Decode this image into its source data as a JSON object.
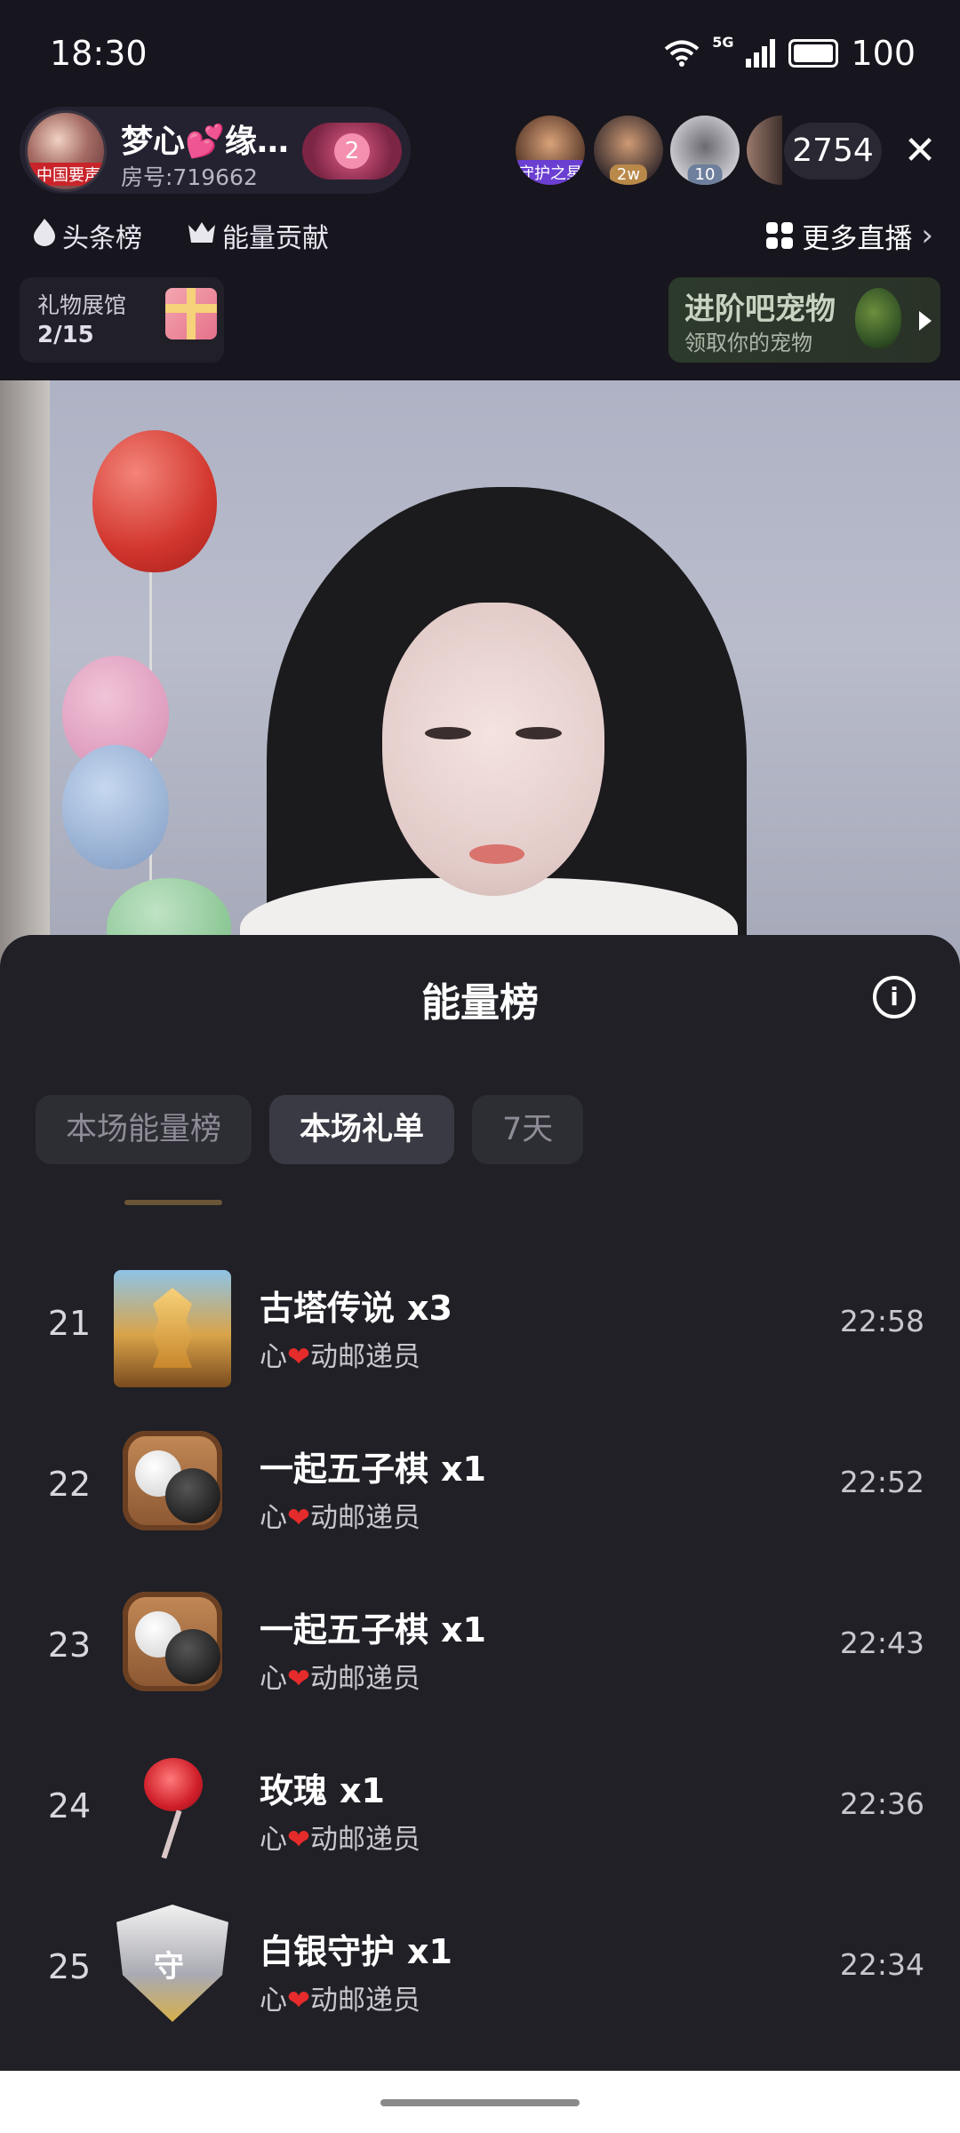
{
  "status_bar": {
    "time": "18:30",
    "network": "5G",
    "battery": "100"
  },
  "room": {
    "host_name": "梦心💕缘…",
    "host_badge": "中国要声",
    "room_number": "房号:719662",
    "fan_level": "2",
    "viewers": [
      {
        "tag": "守护之星",
        "tag_color": "#6a3fd1"
      },
      {
        "tag": "2w",
        "tag_color": "#b9894a"
      },
      {
        "tag": "10",
        "tag_color": "#6d7f9c"
      }
    ],
    "viewer_count": "2754",
    "close_label": "✕"
  },
  "chips": {
    "headline": "头条榜",
    "energy_contrib": "能量贡献",
    "more_live": "更多直播"
  },
  "gift_gallery": {
    "label": "礼物展馆",
    "count": "2/15"
  },
  "pet_banner": {
    "title": "进阶吧宠物",
    "subtitle": "领取你的宠物"
  },
  "sheet": {
    "title": "能量榜",
    "tabs": [
      {
        "label": "本场能量榜",
        "active": false
      },
      {
        "label": "本场礼单",
        "active": true
      },
      {
        "label": "7天",
        "active": false
      }
    ],
    "rows": [
      {
        "rank": "21",
        "gift": "古塔传说",
        "qty": "x3",
        "sender_prefix": "心",
        "sender_heart": "❤",
        "sender_suffix": "动邮递员",
        "time": "22:58",
        "icon": "tower-icon"
      },
      {
        "rank": "22",
        "gift": "一起五子棋",
        "qty": "x1",
        "sender_prefix": "心",
        "sender_heart": "❤",
        "sender_suffix": "动邮递员",
        "time": "22:52",
        "icon": "gomoku-icon"
      },
      {
        "rank": "23",
        "gift": "一起五子棋",
        "qty": "x1",
        "sender_prefix": "心",
        "sender_heart": "❤",
        "sender_suffix": "动邮递员",
        "time": "22:43",
        "icon": "gomoku-icon"
      },
      {
        "rank": "24",
        "gift": "玫瑰",
        "qty": "x1",
        "sender_prefix": "心",
        "sender_heart": "❤",
        "sender_suffix": "动邮递员",
        "time": "22:36",
        "icon": "rose-icon"
      },
      {
        "rank": "25",
        "gift": "白银守护",
        "qty": "x1",
        "sender_prefix": "心",
        "sender_heart": "❤",
        "sender_suffix": "动邮递员",
        "time": "22:34",
        "icon": "silver-guard-icon"
      }
    ]
  }
}
